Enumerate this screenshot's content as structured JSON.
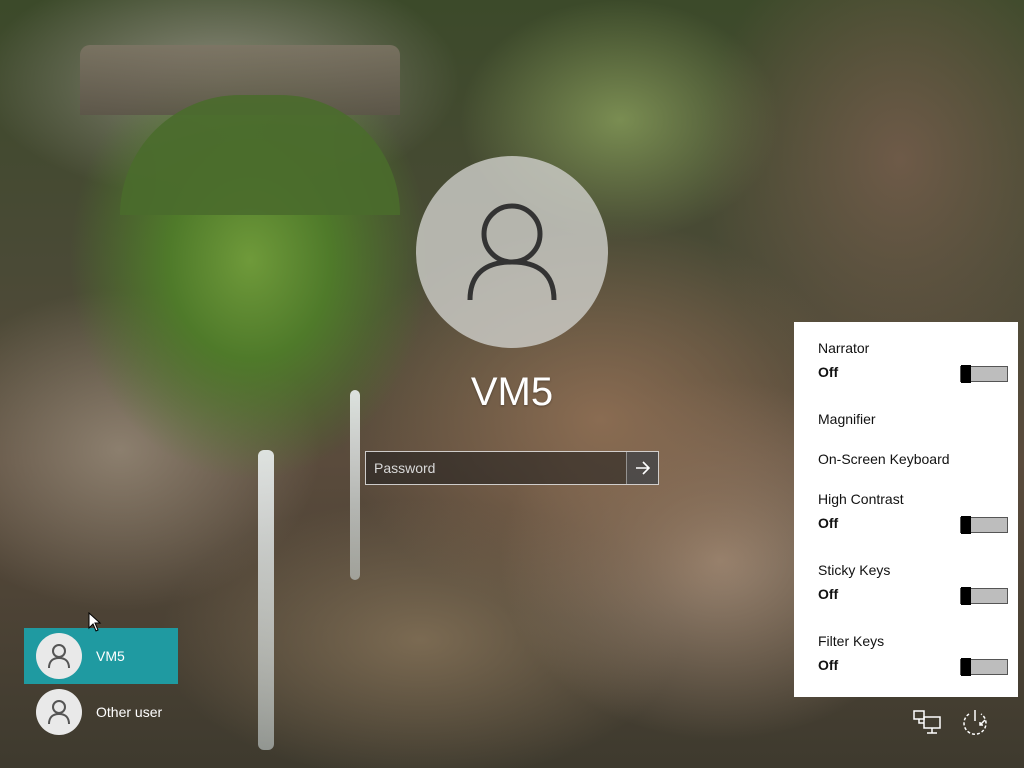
{
  "login": {
    "username": "VM5",
    "password_placeholder": "Password"
  },
  "users": [
    {
      "name": "VM5",
      "selected": true
    },
    {
      "name": "Other user",
      "selected": false
    }
  ],
  "ease_of_access": {
    "narrator": {
      "label": "Narrator",
      "state": "Off"
    },
    "magnifier": {
      "label": "Magnifier"
    },
    "onscreen_keyboard": {
      "label": "On-Screen Keyboard"
    },
    "high_contrast": {
      "label": "High Contrast",
      "state": "Off"
    },
    "sticky_keys": {
      "label": "Sticky Keys",
      "state": "Off"
    },
    "filter_keys": {
      "label": "Filter Keys",
      "state": "Off"
    }
  },
  "icons": {
    "network": "network-icon",
    "power": "power-icon",
    "submit": "arrow-right-icon",
    "avatar": "user-icon"
  },
  "colors": {
    "selected_user": "#1f9aa1",
    "panel_bg": "#ffffff"
  }
}
